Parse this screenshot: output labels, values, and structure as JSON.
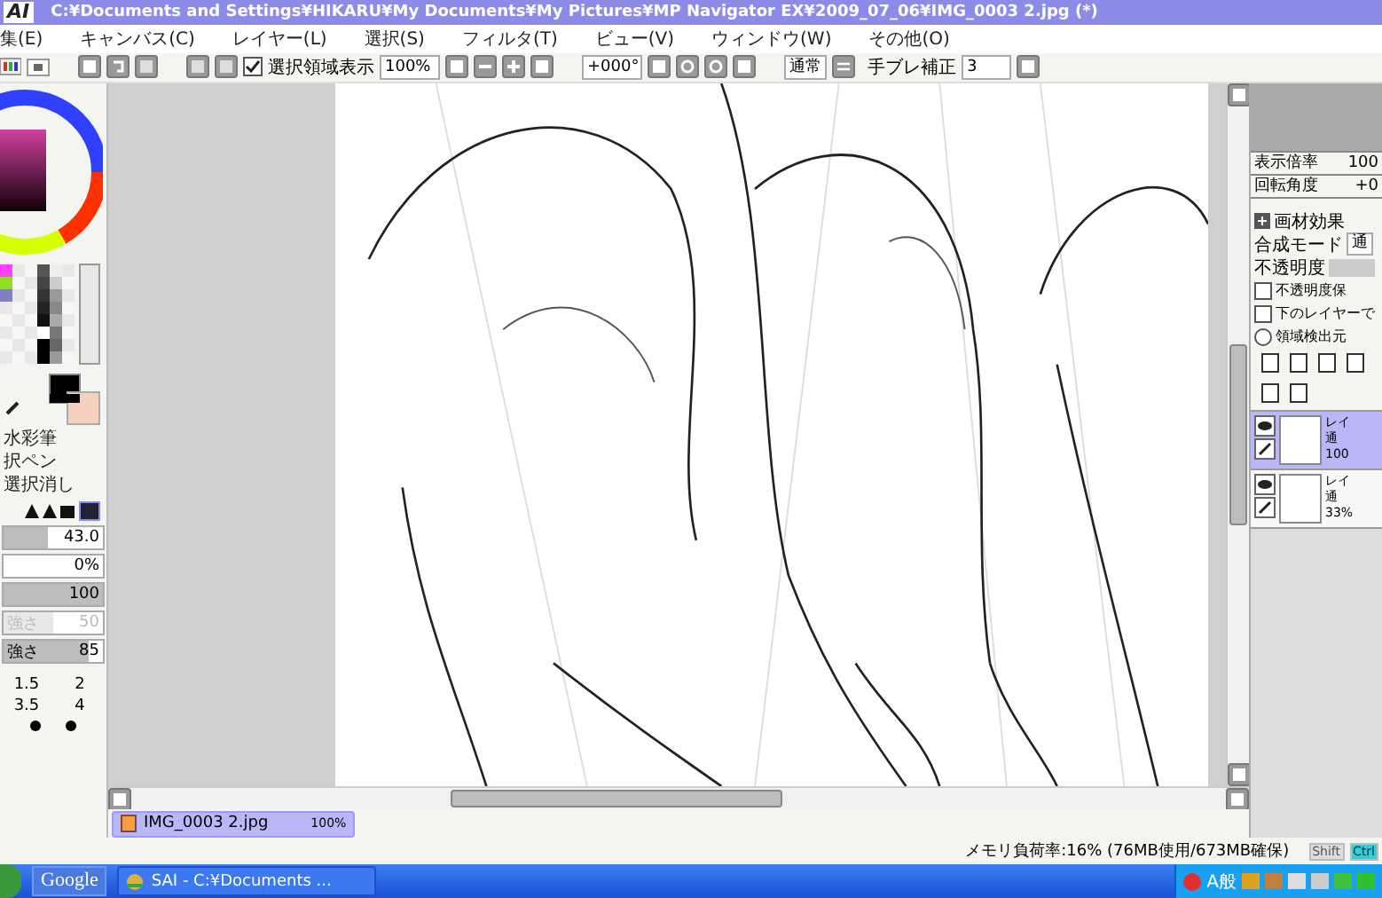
{
  "title_bar": {
    "logo": "AI",
    "path": "C:¥Documents and Settings¥HIKARU¥My Documents¥My Pictures¥MP Navigator EX¥2009_07_06¥IMG_0003 2.jpg (*)"
  },
  "menu": [
    "集(E)",
    "キャンバス(C)",
    "レイヤー(L)",
    "選択(S)",
    "フィルタ(T)",
    "ビュー(V)",
    "ウィンドウ(W)",
    "その他(O)"
  ],
  "toolbar": {
    "show_selection": {
      "label": "選択領域表示",
      "checked": true
    },
    "zoom": "100%",
    "rotation": "+000°",
    "blend": "通常",
    "stabilizer": {
      "label": "手ブレ補正",
      "value": "3"
    }
  },
  "tools": [
    {
      "label": "水彩筆"
    },
    {
      "label": "択ペン"
    },
    {
      "label": "選択消し"
    }
  ],
  "brush_settings": [
    {
      "kind": "slider",
      "value": "43.0",
      "level": 0.45,
      "disabled": false
    },
    {
      "kind": "field",
      "value": "0%"
    },
    {
      "kind": "slider",
      "value": "100",
      "level": 1,
      "disabled": false
    },
    {
      "kind": "slider",
      "label": "強さ",
      "value": "50",
      "level": 0.5,
      "disabled": true
    },
    {
      "kind": "slider",
      "label": "強さ",
      "value": "85",
      "level": 0.85,
      "disabled": false
    }
  ],
  "brush_sizes": [
    "1.5",
    "2",
    "3.5",
    "4"
  ],
  "navigator": {
    "zoom_label": "表示倍率",
    "zoom": "100",
    "angle_label": "回転角度",
    "angle": "+0"
  },
  "layer_panel": {
    "texture_label": "画材効果",
    "blend_label": "合成モード",
    "blend": "通",
    "opacity_label": "不透明度",
    "opacity_slider": {
      "level": 1
    },
    "options": [
      {
        "kind": "checkbox",
        "label": "不透明度保",
        "checked": false
      },
      {
        "kind": "checkbox",
        "label": "下のレイヤーで",
        "checked": false
      },
      {
        "kind": "radio",
        "label": "領域検出元",
        "checked": false
      }
    ],
    "layers": [
      {
        "name": "レイ",
        "mode": "通",
        "opacity": "100",
        "selected": true
      },
      {
        "name": "レイ",
        "mode": "通",
        "opacity": "33%",
        "selected": false
      }
    ]
  },
  "document_tabs": [
    {
      "name": "IMG_0003 2.jpg",
      "zoom": "100%",
      "selected": true
    }
  ],
  "status": {
    "memory": "メモリ負荷率:16% (76MB使用/673MB確保)",
    "keys": [
      {
        "label": "Shift",
        "on": false
      },
      {
        "label": "Ctrl",
        "on": true
      }
    ]
  },
  "taskbar": {
    "search": "Google",
    "tasks": [
      {
        "label": "SAI - C:¥Documents ...",
        "selected": false
      }
    ],
    "ime": "A般"
  }
}
